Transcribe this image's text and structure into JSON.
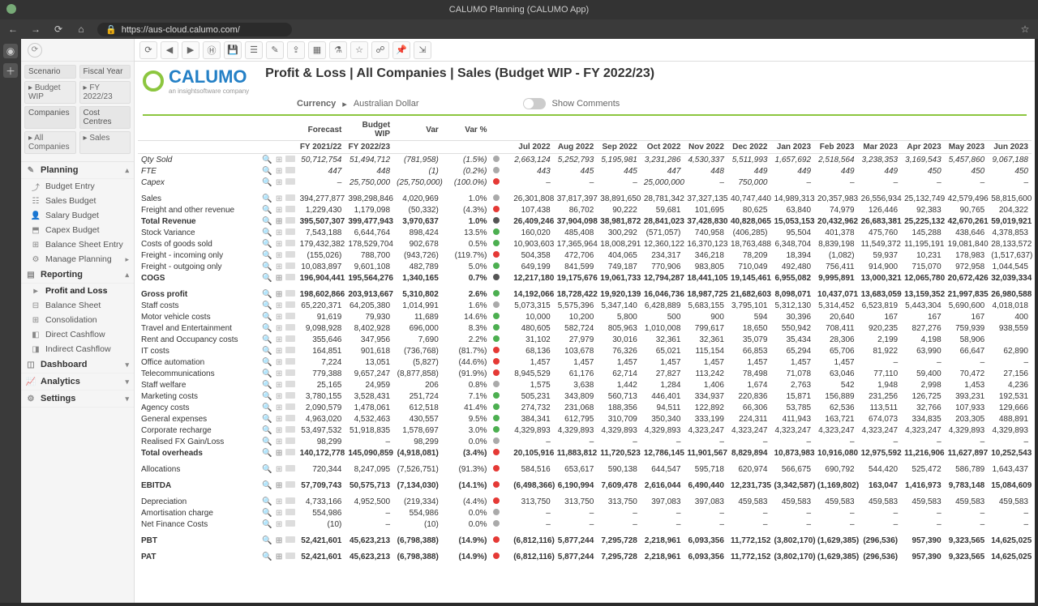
{
  "browser": {
    "title": "CALUMO Planning (CALUMO App)",
    "url": "https://aus-cloud.calumo.com/"
  },
  "sidebar": {
    "filters": {
      "scenario_label": "Scenario",
      "scenario_value": "Budget WIP",
      "year_label": "Fiscal Year",
      "year_value": "FY 2022/23",
      "companies_label": "Companies",
      "companies_value": "All Companies",
      "cc_label": "Cost Centres",
      "cc_value": "Sales"
    },
    "sections": {
      "planning": "Planning",
      "reporting": "Reporting",
      "dashboard": "Dashboard",
      "analytics": "Analytics",
      "settings": "Settings"
    },
    "planning_items": [
      "Budget Entry",
      "Sales Budget",
      "Salary Budget",
      "Capex Budget",
      "Balance Sheet Entry",
      "Manage Planning"
    ],
    "reporting_items": [
      "Profit and Loss",
      "Balance Sheet",
      "Consolidation",
      "Direct Cashflow",
      "Indirect Cashflow"
    ]
  },
  "header": {
    "logo_text": "CALUMO",
    "logo_sub": "an insightsoftware company",
    "title": "Profit & Loss | All Companies | Sales (Budget WIP - FY 2022/23)",
    "currency_label": "Currency",
    "currency_value": "Australian Dollar",
    "show_comments": "Show Comments"
  },
  "columns": {
    "forecast_h": "Forecast",
    "budget_h": "Budget WIP",
    "var_h": "Var",
    "varpct_h": "Var %",
    "forecast": "FY 2021/22",
    "budget": "FY 2022/23",
    "months": [
      "Jul 2022",
      "Aug 2022",
      "Sep 2022",
      "Oct 2022",
      "Nov 2022",
      "Dec 2022",
      "Jan 2023",
      "Feb 2023",
      "Mar 2023",
      "Apr 2023",
      "May 2023",
      "Jun 2023"
    ]
  },
  "rows": [
    {
      "label": "Qty Sold",
      "style": "i",
      "fc": "50,712,754",
      "bw": "51,494,712",
      "var": "(781,958)",
      "vp": "(1.5%)",
      "dot": "gr",
      "m": [
        "2,663,124",
        "5,252,793",
        "5,195,981",
        "3,231,286",
        "4,530,337",
        "5,511,993",
        "1,657,692",
        "2,518,564",
        "3,238,353",
        "3,169,543",
        "5,457,860",
        "9,067,188"
      ]
    },
    {
      "label": "FTE",
      "style": "i",
      "fc": "447",
      "bw": "448",
      "var": "(1)",
      "vp": "(0.2%)",
      "dot": "gr",
      "m": [
        "443",
        "445",
        "445",
        "447",
        "448",
        "449",
        "449",
        "449",
        "449",
        "450",
        "450",
        "450"
      ]
    },
    {
      "label": "Capex",
      "style": "i",
      "fc": "–",
      "bw": "25,750,000",
      "var": "(25,750,000)",
      "vp": "(100.0%)",
      "dot": "r",
      "m": [
        "–",
        "–",
        "–",
        "25,000,000",
        "–",
        "750,000",
        "–",
        "–",
        "–",
        "–",
        "–",
        "–"
      ]
    },
    {
      "spacer": true
    },
    {
      "label": "Sales",
      "fc": "394,277,877",
      "bw": "398,298,846",
      "var": "4,020,969",
      "vp": "1.0%",
      "dot": "gr",
      "m": [
        "26,301,808",
        "37,817,397",
        "38,891,650",
        "28,781,342",
        "37,327,135",
        "40,747,440",
        "14,989,313",
        "20,357,983",
        "26,556,934",
        "25,132,749",
        "42,579,496",
        "58,815,600"
      ]
    },
    {
      "label": "Freight and other revenue",
      "fc": "1,229,430",
      "bw": "1,179,098",
      "var": "(50,332)",
      "vp": "(4.3%)",
      "dot": "r",
      "m": [
        "107,438",
        "86,702",
        "90,222",
        "59,681",
        "101,695",
        "80,625",
        "63,840",
        "74,979",
        "126,446",
        "92,383",
        "90,765",
        "204,322"
      ]
    },
    {
      "label": "Total Revenue",
      "style": "b",
      "fc": "395,507,307",
      "bw": "399,477,943",
      "var": "3,970,637",
      "vp": "1.0%",
      "dot": "k",
      "m": [
        "26,409,246",
        "37,904,098",
        "38,981,872",
        "28,841,023",
        "37,428,830",
        "40,828,065",
        "15,053,153",
        "20,432,962",
        "26,683,381",
        "25,225,132",
        "42,670,261",
        "59,019,921"
      ]
    },
    {
      "label": "Stock Variance",
      "fc": "7,543,188",
      "bw": "6,644,764",
      "var": "898,424",
      "vp": "13.5%",
      "dot": "g",
      "m": [
        "160,020",
        "485,408",
        "300,292",
        "(571,057)",
        "740,958",
        "(406,285)",
        "95,504",
        "401,378",
        "475,760",
        "145,288",
        "438,646",
        "4,378,853"
      ]
    },
    {
      "label": "Costs of goods sold",
      "fc": "179,432,382",
      "bw": "178,529,704",
      "var": "902,678",
      "vp": "0.5%",
      "dot": "g",
      "m": [
        "10,903,603",
        "17,365,964",
        "18,008,291",
        "12,360,122",
        "16,370,123",
        "18,763,488",
        "6,348,704",
        "8,839,198",
        "11,549,372",
        "11,195,191",
        "19,081,840",
        "28,133,572"
      ]
    },
    {
      "label": "Freight - incoming only",
      "fc": "(155,026)",
      "bw": "788,700",
      "var": "(943,726)",
      "vp": "(119.7%)",
      "dot": "r",
      "m": [
        "504,358",
        "472,706",
        "404,065",
        "234,317",
        "346,218",
        "78,209",
        "18,394",
        "(1,082)",
        "59,937",
        "10,231",
        "178,983",
        "(1,517,637)"
      ]
    },
    {
      "label": "Freight - outgoing only",
      "fc": "10,083,897",
      "bw": "9,601,108",
      "var": "482,789",
      "vp": "5.0%",
      "dot": "g",
      "m": [
        "649,199",
        "841,599",
        "749,187",
        "770,906",
        "983,805",
        "710,049",
        "492,480",
        "756,411",
        "914,900",
        "715,070",
        "972,958",
        "1,044,545"
      ]
    },
    {
      "label": "COGS",
      "style": "b",
      "fc": "196,904,441",
      "bw": "195,564,276",
      "var": "1,340,165",
      "vp": "0.7%",
      "dot": "k",
      "m": [
        "12,217,180",
        "19,175,676",
        "19,061,733",
        "12,794,287",
        "18,441,105",
        "19,145,461",
        "6,955,082",
        "9,995,891",
        "13,000,321",
        "12,065,780",
        "20,672,426",
        "32,039,334"
      ]
    },
    {
      "spacer": true
    },
    {
      "label": "Gross profit",
      "style": "b",
      "fc": "198,602,866",
      "bw": "203,913,667",
      "var": "5,310,802",
      "vp": "2.6%",
      "dot": "g",
      "m": [
        "14,192,066",
        "18,728,422",
        "19,920,139",
        "16,046,736",
        "18,987,725",
        "21,682,603",
        "8,098,071",
        "10,437,071",
        "13,683,059",
        "13,159,352",
        "21,997,835",
        "26,980,588"
      ]
    },
    {
      "label": "Staff costs",
      "fc": "65,220,371",
      "bw": "64,205,380",
      "var": "1,014,991",
      "vp": "1.6%",
      "dot": "gr",
      "m": [
        "5,073,315",
        "5,575,396",
        "5,347,140",
        "6,428,889",
        "5,683,155",
        "3,795,101",
        "5,312,130",
        "5,314,452",
        "6,523,819",
        "5,443,304",
        "5,690,600",
        "4,018,018"
      ]
    },
    {
      "label": "Motor vehicle costs",
      "fc": "91,619",
      "bw": "79,930",
      "var": "11,689",
      "vp": "14.6%",
      "dot": "g",
      "m": [
        "10,000",
        "10,200",
        "5,800",
        "500",
        "900",
        "594",
        "30,396",
        "20,640",
        "167",
        "167",
        "167",
        "400"
      ]
    },
    {
      "label": "Travel and Entertainment",
      "fc": "9,098,928",
      "bw": "8,402,928",
      "var": "696,000",
      "vp": "8.3%",
      "dot": "g",
      "m": [
        "480,605",
        "582,724",
        "805,963",
        "1,010,008",
        "799,617",
        "18,650",
        "550,942",
        "708,411",
        "920,235",
        "827,276",
        "759,939",
        "938,559"
      ]
    },
    {
      "label": "Rent and Occupancy costs",
      "fc": "355,646",
      "bw": "347,956",
      "var": "7,690",
      "vp": "2.2%",
      "dot": "g",
      "m": [
        "31,102",
        "27,979",
        "30,016",
        "32,361",
        "32,361",
        "35,079",
        "35,434",
        "28,306",
        "2,199",
        "4,198",
        "58,906",
        ""
      ]
    },
    {
      "label": "IT costs",
      "fc": "164,851",
      "bw": "901,618",
      "var": "(736,768)",
      "vp": "(81.7%)",
      "dot": "r",
      "m": [
        "68,136",
        "103,678",
        "76,326",
        "65,021",
        "115,154",
        "66,853",
        "65,294",
        "65,706",
        "81,922",
        "63,990",
        "66,647",
        "62,890"
      ]
    },
    {
      "label": "Office automation",
      "fc": "7,224",
      "bw": "13,051",
      "var": "(5,827)",
      "vp": "(44.6%)",
      "dot": "r",
      "m": [
        "1,457",
        "1,457",
        "1,457",
        "1,457",
        "1,457",
        "1,457",
        "1,457",
        "1,457",
        "–",
        "–",
        "–",
        "–"
      ]
    },
    {
      "label": "Telecommunications",
      "fc": "779,388",
      "bw": "9,657,247",
      "var": "(8,877,858)",
      "vp": "(91.9%)",
      "dot": "r",
      "m": [
        "8,945,529",
        "61,176",
        "62,714",
        "27,827",
        "113,242",
        "78,498",
        "71,078",
        "63,046",
        "77,110",
        "59,400",
        "70,472",
        "27,156"
      ]
    },
    {
      "label": "Staff welfare",
      "fc": "25,165",
      "bw": "24,959",
      "var": "206",
      "vp": "0.8%",
      "dot": "gr",
      "m": [
        "1,575",
        "3,638",
        "1,442",
        "1,284",
        "1,406",
        "1,674",
        "2,763",
        "542",
        "1,948",
        "2,998",
        "1,453",
        "4,236"
      ]
    },
    {
      "label": "Marketing costs",
      "fc": "3,780,155",
      "bw": "3,528,431",
      "var": "251,724",
      "vp": "7.1%",
      "dot": "g",
      "m": [
        "505,231",
        "343,809",
        "560,713",
        "446,401",
        "334,937",
        "220,836",
        "15,871",
        "156,889",
        "231,256",
        "126,725",
        "393,231",
        "192,531"
      ]
    },
    {
      "label": "Agency costs",
      "fc": "2,090,579",
      "bw": "1,478,061",
      "var": "612,518",
      "vp": "41.4%",
      "dot": "g",
      "m": [
        "274,732",
        "231,068",
        "188,356",
        "94,511",
        "122,892",
        "66,306",
        "53,785",
        "62,536",
        "113,511",
        "32,766",
        "107,933",
        "129,666"
      ]
    },
    {
      "label": "General expenses",
      "fc": "4,963,020",
      "bw": "4,532,463",
      "var": "430,557",
      "vp": "9.5%",
      "dot": "g",
      "m": [
        "384,341",
        "612,795",
        "310,709",
        "350,340",
        "333,199",
        "224,311",
        "411,943",
        "163,721",
        "674,073",
        "334,835",
        "203,305",
        "488,891"
      ]
    },
    {
      "label": "Corporate recharge",
      "fc": "53,497,532",
      "bw": "51,918,835",
      "var": "1,578,697",
      "vp": "3.0%",
      "dot": "g",
      "m": [
        "4,329,893",
        "4,329,893",
        "4,329,893",
        "4,329,893",
        "4,323,247",
        "4,323,247",
        "4,323,247",
        "4,323,247",
        "4,323,247",
        "4,323,247",
        "4,329,893",
        "4,329,893"
      ]
    },
    {
      "label": "Realised FX Gain/Loss",
      "fc": "98,299",
      "bw": "–",
      "var": "98,299",
      "vp": "0.0%",
      "dot": "gr",
      "m": [
        "–",
        "–",
        "–",
        "–",
        "–",
        "–",
        "–",
        "–",
        "–",
        "–",
        "–",
        "–"
      ]
    },
    {
      "label": "Total overheads",
      "style": "b",
      "fc": "140,172,778",
      "bw": "145,090,859",
      "var": "(4,918,081)",
      "vp": "(3.4%)",
      "dot": "r",
      "m": [
        "20,105,916",
        "11,883,812",
        "11,720,523",
        "12,786,145",
        "11,901,567",
        "8,829,894",
        "10,873,983",
        "10,916,080",
        "12,975,592",
        "11,216,906",
        "11,627,897",
        "10,252,543"
      ]
    },
    {
      "spacer": true
    },
    {
      "label": "Allocations",
      "fc": "720,344",
      "bw": "8,247,095",
      "var": "(7,526,751)",
      "vp": "(91.3%)",
      "dot": "r",
      "m": [
        "584,516",
        "653,617",
        "590,138",
        "644,547",
        "595,718",
        "620,974",
        "566,675",
        "690,792",
        "544,420",
        "525,472",
        "586,789",
        "1,643,437"
      ]
    },
    {
      "spacer": true
    },
    {
      "label": "EBITDA",
      "style": "b",
      "fc": "57,709,743",
      "bw": "50,575,713",
      "var": "(7,134,030)",
      "vp": "(14.1%)",
      "dot": "r",
      "m": [
        "(6,498,366)",
        "6,190,994",
        "7,609,478",
        "2,616,044",
        "6,490,440",
        "12,231,735",
        "(3,342,587)",
        "(1,169,802)",
        "163,047",
        "1,416,973",
        "9,783,148",
        "15,084,609"
      ]
    },
    {
      "spacer": true
    },
    {
      "label": "Depreciation",
      "fc": "4,733,166",
      "bw": "4,952,500",
      "var": "(219,334)",
      "vp": "(4.4%)",
      "dot": "r",
      "m": [
        "313,750",
        "313,750",
        "313,750",
        "397,083",
        "397,083",
        "459,583",
        "459,583",
        "459,583",
        "459,583",
        "459,583",
        "459,583",
        "459,583"
      ]
    },
    {
      "label": "Amortisation charge",
      "fc": "554,986",
      "bw": "–",
      "var": "554,986",
      "vp": "0.0%",
      "dot": "gr",
      "m": [
        "–",
        "–",
        "–",
        "–",
        "–",
        "–",
        "–",
        "–",
        "–",
        "–",
        "–",
        "–"
      ]
    },
    {
      "label": "Net Finance Costs",
      "fc": "(10)",
      "bw": "–",
      "var": "(10)",
      "vp": "0.0%",
      "dot": "gr",
      "m": [
        "–",
        "–",
        "–",
        "–",
        "–",
        "–",
        "–",
        "–",
        "–",
        "–",
        "–",
        "–"
      ]
    },
    {
      "spacer": true
    },
    {
      "label": "PBT",
      "style": "b",
      "fc": "52,421,601",
      "bw": "45,623,213",
      "var": "(6,798,388)",
      "vp": "(14.9%)",
      "dot": "r",
      "m": [
        "(6,812,116)",
        "5,877,244",
        "7,295,728",
        "2,218,961",
        "6,093,356",
        "11,772,152",
        "(3,802,170)",
        "(1,629,385)",
        "(296,536)",
        "957,390",
        "9,323,565",
        "14,625,025"
      ]
    },
    {
      "spacer": true
    },
    {
      "label": "PAT",
      "style": "b",
      "fc": "52,421,601",
      "bw": "45,623,213",
      "var": "(6,798,388)",
      "vp": "(14.9%)",
      "dot": "r",
      "m": [
        "(6,812,116)",
        "5,877,244",
        "7,295,728",
        "2,218,961",
        "6,093,356",
        "11,772,152",
        "(3,802,170)",
        "(1,629,385)",
        "(296,536)",
        "957,390",
        "9,323,565",
        "14,625,025"
      ]
    }
  ]
}
